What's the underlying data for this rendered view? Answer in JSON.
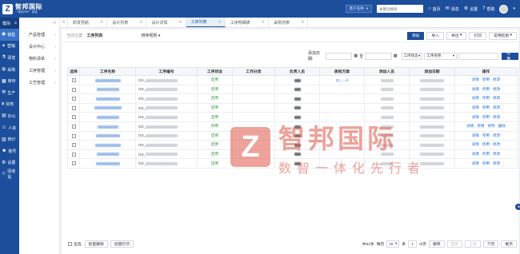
{
  "app": {
    "logo_mark": "Z",
    "logo_name": "智邦国际",
    "logo_slogan": "一体化ERP · 系统"
  },
  "topbar": {
    "customer_select": "客户名称",
    "search_placeholder": "关键词搜索",
    "links": [
      {
        "icon": "home-icon",
        "glyph": "⌂",
        "label": "首页"
      },
      {
        "icon": "message-icon",
        "glyph": "✉",
        "label": "消息"
      },
      {
        "icon": "settings-icon",
        "glyph": "⚙",
        "label": "设置"
      },
      {
        "icon": "help-icon",
        "glyph": "?",
        "label": "帮助"
      }
    ]
  },
  "sidebar": {
    "header": "模块",
    "items": [
      {
        "label": "销售",
        "glyph": "◉"
      },
      {
        "label": "营销",
        "glyph": "✦"
      },
      {
        "label": "研发",
        "glyph": "⚗"
      },
      {
        "label": "采购",
        "glyph": "◍"
      },
      {
        "label": "库存",
        "glyph": "▦"
      },
      {
        "label": "生产",
        "glyph": "⚒"
      },
      {
        "label": "财务",
        "glyph": "¥"
      },
      {
        "label": "办公",
        "glyph": "▤"
      },
      {
        "label": "人资",
        "glyph": "☺"
      },
      {
        "label": "统计",
        "glyph": "▥"
      },
      {
        "label": "账号",
        "glyph": "☻"
      },
      {
        "label": "设置",
        "glyph": "⚙"
      },
      {
        "label": "回收站",
        "glyph": "♲"
      }
    ]
  },
  "submenu": {
    "collapse": "«",
    "items": [
      {
        "label": "产品管理"
      },
      {
        "label": "设计中心"
      },
      {
        "label": "物料清单"
      },
      {
        "label": "工序管理"
      },
      {
        "label": "工艺管理"
      }
    ]
  },
  "tabs": [
    {
      "label": "研发导航"
    },
    {
      "label": "设计列表"
    },
    {
      "label": "设计详情"
    },
    {
      "label": "工序列表",
      "active": true
    },
    {
      "label": "工序明细表"
    },
    {
      "label": "采购列表"
    }
  ],
  "toolbar": {
    "crumb_prefix": "当前位置:",
    "crumb_current": "工序列表",
    "sort_label": "排序规则",
    "buttons": [
      "添加",
      "导入",
      "导出",
      "打印",
      "常用检索"
    ]
  },
  "filter": {
    "date_label": "添加日期:",
    "date_sep": "至",
    "select1": "工序状态",
    "select2": "工序名称",
    "search_button": "检索"
  },
  "table": {
    "columns": [
      "选择",
      "工序名称",
      "工序编号",
      "工序状态",
      "工作分类",
      "负责人员",
      "质检方案",
      "添加人员",
      "添加日期",
      "操作"
    ],
    "rows": [
      {
        "code": "GX_",
        "status": "启用",
        "plan": "ZJ_...-2",
        "ops": [
          "详情",
          "停用",
          "修改"
        ]
      },
      {
        "code": "GX_",
        "status": "启用",
        "plan": "",
        "ops": [
          "详情",
          "停用",
          "修改"
        ]
      },
      {
        "code": "GX_",
        "status": "启用",
        "plan": "",
        "ops": [
          "详情",
          "停用",
          "修改"
        ]
      },
      {
        "code": "GX_",
        "status": "启用",
        "plan": "",
        "ops": [
          "详情",
          "停用",
          "修改"
        ]
      },
      {
        "code": "GX_",
        "status": "启用",
        "plan": "",
        "ops": [
          "详情",
          "停用",
          "修改"
        ]
      },
      {
        "code": "GX_",
        "status": "停用",
        "plan": "",
        "ops": [
          "详情",
          "停用",
          "修改",
          "删除"
        ]
      },
      {
        "code": "GX_",
        "status": "启用",
        "plan": "",
        "ops": [
          "详情",
          "停用",
          "修改"
        ]
      },
      {
        "code": "GX_",
        "status": "启用",
        "plan": "",
        "ops": [
          "详情",
          "停用",
          "修改"
        ]
      },
      {
        "code": "GX_",
        "status": "启用",
        "plan": "",
        "ops": [
          "详情",
          "停用",
          "修改"
        ]
      },
      {
        "code": "GX_",
        "status": "启用",
        "plan": "",
        "ops": [
          "详情",
          "停用",
          "修改"
        ]
      }
    ]
  },
  "footer": {
    "select_all": "全选",
    "batch_delete": "批量删除",
    "batch_print": "批量打印",
    "total": "共51条",
    "per_page_label": "每页",
    "per_page": "10",
    "per_page_unit": "条",
    "page": "1",
    "page_total": "/5页",
    "jump": "跳转",
    "first": "首页",
    "prev": "上页",
    "next": "下页",
    "last": "尾页"
  },
  "watermark": {
    "mark": "Z",
    "title": "智邦国际",
    "slogan": "数智一体化先行者"
  },
  "colors": {
    "brand": "#1d4e9b",
    "link": "#1d6fd8",
    "status_on": "#2e9a3a",
    "watermark": "#e0574b"
  }
}
